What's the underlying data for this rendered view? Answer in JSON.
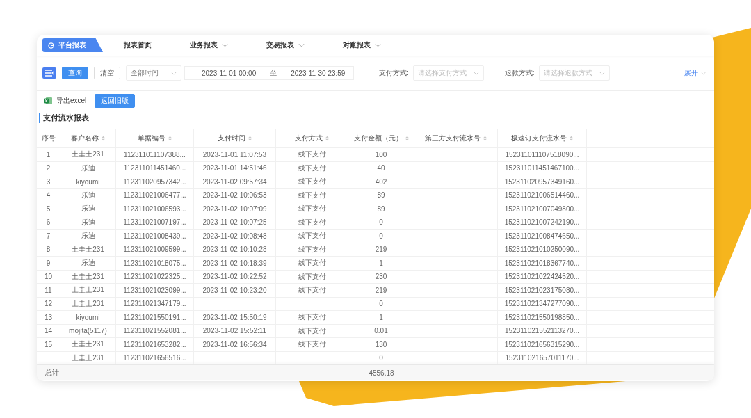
{
  "nav": [
    {
      "label": "平台报表",
      "selected": true,
      "dropdown": false
    },
    {
      "label": "报表首页",
      "selected": false,
      "dropdown": false
    },
    {
      "label": "业务报表",
      "selected": false,
      "dropdown": true
    },
    {
      "label": "交易报表",
      "selected": false,
      "dropdown": true
    },
    {
      "label": "对账报表",
      "selected": false,
      "dropdown": true
    }
  ],
  "filters": {
    "query_button": "查询",
    "clear_button": "清空",
    "time_select": "全部时间",
    "start": "2023-11-01 00:00",
    "range_sep": "至",
    "end": "2023-11-30 23:59",
    "pay_label": "支付方式:",
    "pay_placeholder": "请选择支付方式",
    "refund_label": "退款方式:",
    "refund_placeholder": "请选择退款方式",
    "expand": "展开"
  },
  "actions": {
    "export": "导出excel",
    "back": "返回旧版"
  },
  "report_title": "支付流水报表",
  "table": {
    "columns": [
      {
        "label": "序号",
        "sortable": false
      },
      {
        "label": "客户名称",
        "sortable": true
      },
      {
        "label": "单据编号",
        "sortable": true
      },
      {
        "label": "支付时间",
        "sortable": true
      },
      {
        "label": "支付方式",
        "sortable": true
      },
      {
        "label": "支付金额（元）",
        "sortable": true
      },
      {
        "label": "第三方支付流水号",
        "sortable": true
      },
      {
        "label": "极速订支付流水号",
        "sortable": true
      }
    ],
    "rows": [
      {
        "no": "1",
        "customer": "土圭土231",
        "doc": "112311011107388...",
        "time": "2023-11-01 11:07:53",
        "method": "线下支付",
        "amount": "100",
        "fast": "152311011107518090..."
      },
      {
        "no": "2",
        "customer": "乐迪",
        "doc": "112311011451460...",
        "time": "2023-11-01 14:51:46",
        "method": "线下支付",
        "amount": "40",
        "fast": "152311011451467100..."
      },
      {
        "no": "3",
        "customer": "kiyoumi",
        "doc": "112311020957342...",
        "time": "2023-11-02 09:57:34",
        "method": "线下支付",
        "amount": "402",
        "fast": "152311020957349160..."
      },
      {
        "no": "4",
        "customer": "乐迪",
        "doc": "112311021006477...",
        "time": "2023-11-02 10:06:53",
        "method": "线下支付",
        "amount": "89",
        "fast": "152311021006514460..."
      },
      {
        "no": "5",
        "customer": "乐迪",
        "doc": "112311021006593...",
        "time": "2023-11-02 10:07:09",
        "method": "线下支付",
        "amount": "89",
        "fast": "152311021007049800..."
      },
      {
        "no": "6",
        "customer": "乐迪",
        "doc": "112311021007197...",
        "time": "2023-11-02 10:07:25",
        "method": "线下支付",
        "amount": "0",
        "fast": "152311021007242190..."
      },
      {
        "no": "7",
        "customer": "乐迪",
        "doc": "112311021008439...",
        "time": "2023-11-02 10:08:48",
        "method": "线下支付",
        "amount": "0",
        "fast": "152311021008474650..."
      },
      {
        "no": "8",
        "customer": "土圭土231",
        "doc": "112311021009599...",
        "time": "2023-11-02 10:10:28",
        "method": "线下支付",
        "amount": "219",
        "fast": "152311021010250090..."
      },
      {
        "no": "9",
        "customer": "乐迪",
        "doc": "112311021018075...",
        "time": "2023-11-02 10:18:39",
        "method": "线下支付",
        "amount": "1",
        "fast": "152311021018367740..."
      },
      {
        "no": "10",
        "customer": "土圭土231",
        "doc": "112311021022325...",
        "time": "2023-11-02 10:22:52",
        "method": "线下支付",
        "amount": "230",
        "fast": "152311021022424520..."
      },
      {
        "no": "11",
        "customer": "土圭土231",
        "doc": "112311021023099...",
        "time": "2023-11-02 10:23:20",
        "method": "线下支付",
        "amount": "219",
        "fast": "152311021023175080..."
      },
      {
        "no": "12",
        "customer": "土圭土231",
        "doc": "112311021347179...",
        "amount": "0",
        "fast": "152311021347277090..."
      },
      {
        "no": "13",
        "customer": "kiyoumi",
        "doc": "112311021550191...",
        "time": "2023-11-02 15:50:19",
        "method": "线下支付",
        "amount": "1",
        "fast": "152311021550198850..."
      },
      {
        "no": "14",
        "customer": "mojita(5117)",
        "doc": "112311021552081...",
        "time": "2023-11-02 15:52:11",
        "method": "线下支付",
        "amount": "0.01",
        "fast": "152311021552113270..."
      },
      {
        "no": "15",
        "customer": "土圭土231",
        "doc": "112311021653282...",
        "time": "2023-11-02 16:56:34",
        "method": "线下支付",
        "amount": "130",
        "fast": "152311021656315290..."
      },
      {
        "customer": "土圭土231",
        "doc": "112311021656516...",
        "amount": "0",
        "fast": "152311021657011170..."
      }
    ],
    "total": {
      "label": "总计",
      "amount": "4556.18"
    }
  }
}
